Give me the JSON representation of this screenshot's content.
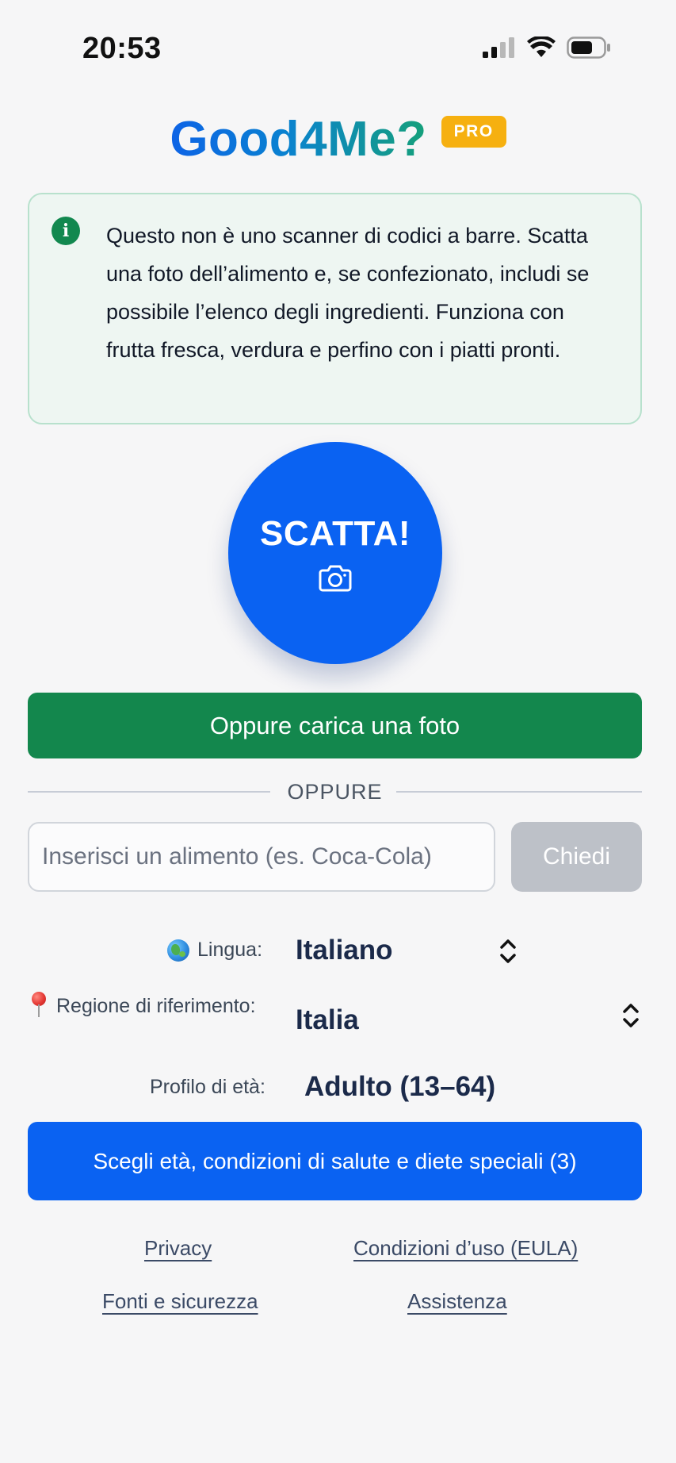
{
  "status_bar": {
    "time": "20:53",
    "icons": [
      "cellular-signal-icon",
      "wifi-icon",
      "battery-icon"
    ]
  },
  "header": {
    "title": "Good4Me?",
    "badge": "PRO"
  },
  "info_card": {
    "icon": "info-icon",
    "text": "Questo non è uno scanner di codici a barre. Scatta una foto dell’alimento e, se confezionato, includi se possibile l’elenco degli ingredienti. Funziona con frutta fresca, verdura e perfino con i piatti pronti."
  },
  "shoot": {
    "label": "SCATTA!",
    "icon": "camera-icon"
  },
  "upload": {
    "label": "Oppure carica una foto"
  },
  "divider": {
    "label": "OPPURE"
  },
  "search": {
    "placeholder": "Inserisci un alimento (es. Coca-Cola)",
    "value": "",
    "button_label": "Chiedi"
  },
  "settings": {
    "language": {
      "label": "Lingua:",
      "value": "Italiano",
      "icon": "globe-icon"
    },
    "region": {
      "label": "Regione di riferimento:",
      "value": "Italia",
      "icon": "pin-icon"
    },
    "age_profile": {
      "label": "Profilo di età:",
      "value": "Adulto (13–64)"
    }
  },
  "profile_button": {
    "label": "Scegli età, condizioni di salute e diete speciali (3)"
  },
  "footer": {
    "links": [
      "Privacy",
      "Condizioni d’uso (EULA)",
      "Fonti e sicurezza",
      "Assistenza"
    ]
  },
  "colors": {
    "primary_blue": "#0a62f2",
    "green": "#13874d",
    "badge_orange": "#f6b010",
    "disabled_gray": "#bdc1c8"
  }
}
